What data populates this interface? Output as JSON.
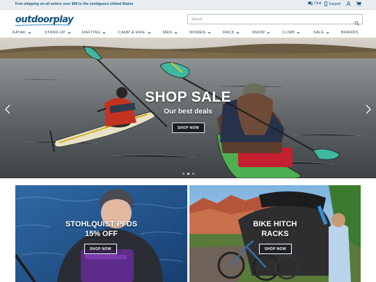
{
  "topbar": {
    "shipping": "Free shipping on all orders over $49 to the contiguous United States",
    "chat": "Chat",
    "support": "Support"
  },
  "header": {
    "logo": "outdoorplay",
    "search_placeholder": "Search"
  },
  "nav": {
    "items": [
      {
        "label": "KAYAK"
      },
      {
        "label": "STAND-UP"
      },
      {
        "label": "RAFTING"
      },
      {
        "label": "CAMP & HIKE"
      },
      {
        "label": "MEN"
      },
      {
        "label": "WOMEN"
      },
      {
        "label": "RACK"
      },
      {
        "label": "SNOW"
      },
      {
        "label": "CLIMB"
      },
      {
        "label": "SALE"
      },
      {
        "label": "BRANDS"
      }
    ]
  },
  "hero": {
    "title": "SHOP SALE",
    "subtitle": "Our best deals",
    "button": "SHOP NOW",
    "slide_count": 3,
    "active_slide": 2
  },
  "tiles": [
    {
      "line1": "STOHLQUIST PFDS",
      "line2": "15% OFF",
      "button": "SHOP NOW"
    },
    {
      "line1": "BIKE HITCH",
      "line2": "RACKS",
      "button": "SHOP NOW"
    }
  ],
  "colors": {
    "brand": "#0d4f7a",
    "topbar_bg": "#e9edf1",
    "button_dark": "#1a1f25"
  },
  "icons": [
    "chat-icon",
    "phone-icon",
    "user-icon",
    "cart-icon",
    "search-icon",
    "chevron-left-icon",
    "chevron-right-icon"
  ]
}
